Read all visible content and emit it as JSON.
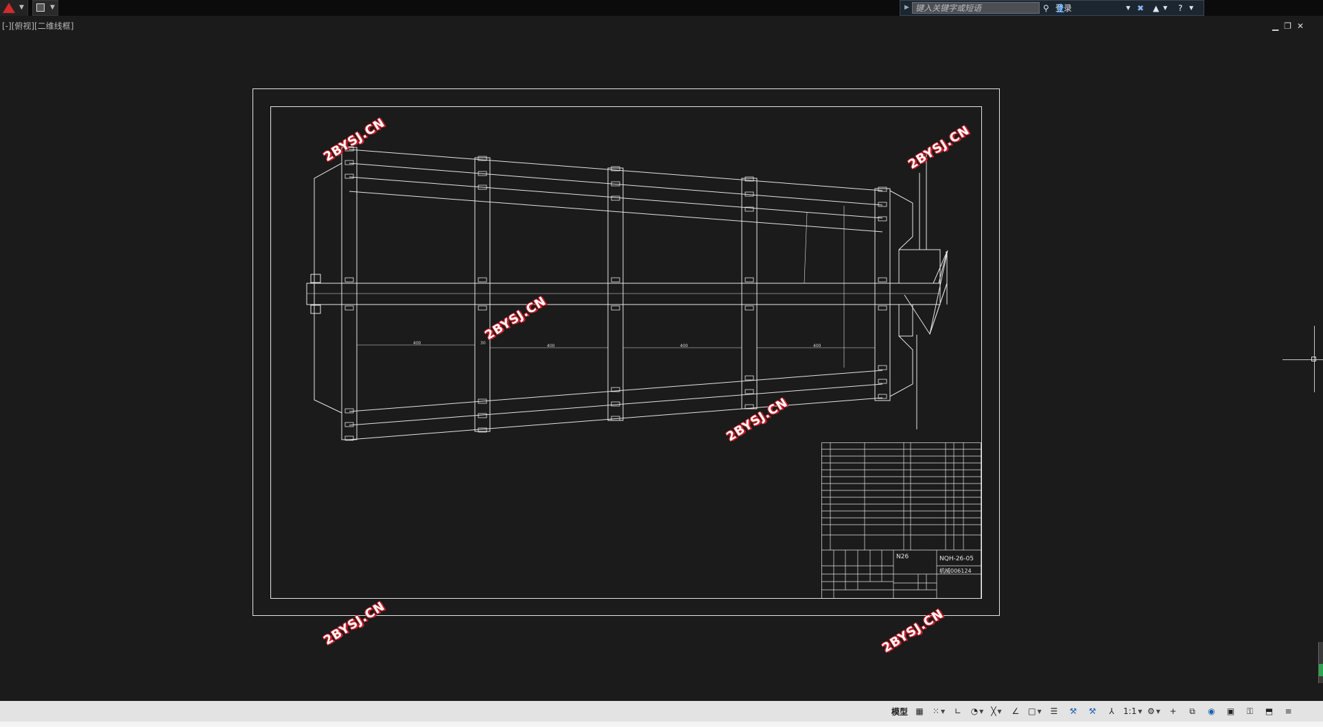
{
  "titlebar": {
    "search_placeholder": "键入关键字或短语",
    "login_label": "登录"
  },
  "viewport": {
    "label": "[-][俯视][二维线框]"
  },
  "watermarks": [
    {
      "text": "2BYSJ.CN"
    },
    {
      "text": "2BYSJ.CN"
    },
    {
      "text": "2BYSJ.CN"
    },
    {
      "text": "2BYSJ.CN"
    },
    {
      "text": "2BYSJ.CN"
    },
    {
      "text": "2BYSJ.CN"
    }
  ],
  "titleblock": {
    "title": "N26",
    "drawing_no": "NQH-26-05",
    "org": "机械006124"
  },
  "dimensions": {
    "d1": "400",
    "d2": "400",
    "d3": "400",
    "d4": "400",
    "d5": "30"
  },
  "statusbar": {
    "model_label": "模型",
    "scale_label": "1:1"
  },
  "icons": [
    "autocad-logo-icon",
    "save-icon",
    "search-icon",
    "binoculars-icon",
    "user-icon",
    "exchange-icon",
    "autodesk-icon",
    "help-icon",
    "minimize-icon",
    "restore-icon",
    "close-icon",
    "grid-icon",
    "snap-icon",
    "ortho-icon",
    "polar-icon",
    "osnap-icon",
    "lineweight-icon",
    "annotation-icon",
    "workspace-icon",
    "settings-icon",
    "plus-icon",
    "isolate-icon",
    "hardware-accel-icon",
    "clean-screen-icon",
    "customize-icon"
  ]
}
